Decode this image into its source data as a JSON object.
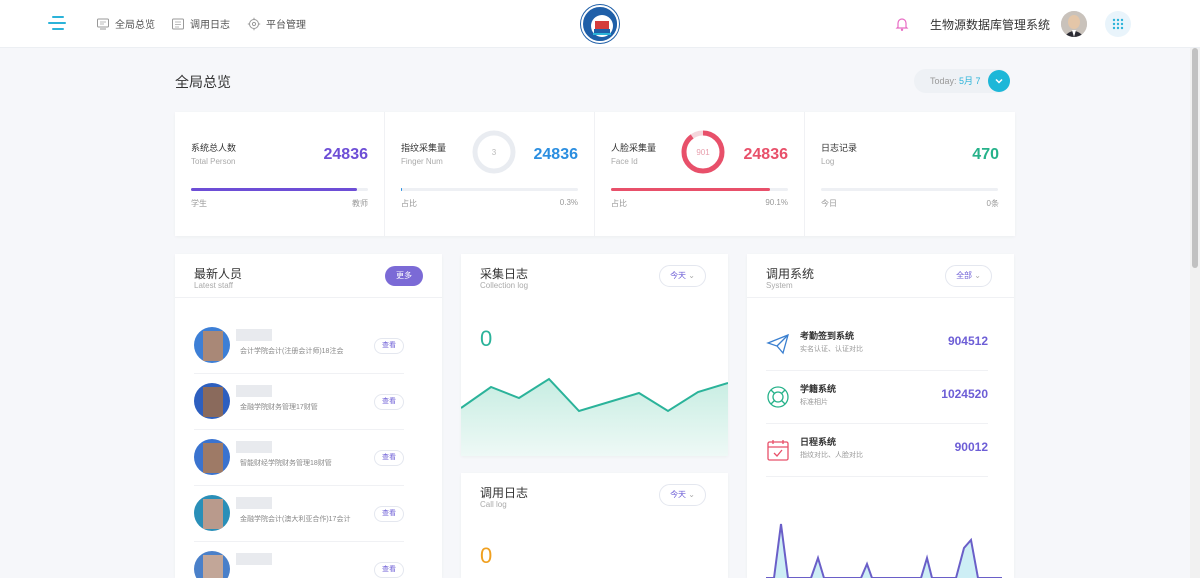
{
  "nav": {
    "items": [
      {
        "label": "全局总览",
        "icon": "monitor-icon"
      },
      {
        "label": "调用日志",
        "icon": "log-icon"
      },
      {
        "label": "平台管理",
        "icon": "gear-icon"
      }
    ],
    "system_title": "生物源数据库管理系统"
  },
  "page": {
    "title": "全局总览",
    "today_prefix": "Today: ",
    "today_month": "5月 7"
  },
  "stats": [
    {
      "label": "系统总人数",
      "sub": "Total Person",
      "value": "24836",
      "color": "#6d4ed6",
      "progress": 0.94,
      "foot_left": "学生",
      "foot_right": "教师"
    },
    {
      "label": "指纹采集量",
      "sub": "Finger Num",
      "value": "24836",
      "color": "#2b8ee0",
      "ring_value": "3",
      "progress": 0.003,
      "foot_left": "占比",
      "foot_right": "0.3%"
    },
    {
      "label": "人脸采集量",
      "sub": "Face Id",
      "value": "24836",
      "color": "#e8506a",
      "ring_value": "901",
      "progress": 0.901,
      "foot_left": "占比",
      "foot_right": "90.1%"
    },
    {
      "label": "日志记录",
      "sub": "Log",
      "value": "470",
      "color": "#26b28a",
      "progress": 0,
      "foot_left": "今日",
      "foot_right": "0条"
    }
  ],
  "staff": {
    "title": "最新人员",
    "sub": "Latest staff",
    "more": "更多",
    "view_label": "查看",
    "rows": [
      {
        "info": "会计学院会计(注册会计师)18注会"
      },
      {
        "info": "金融学院财务管理17财管"
      },
      {
        "info": "智能财经学院财务管理18财管"
      },
      {
        "info": "金融学院会计(澳大利亚合作)17会计"
      },
      {
        "info": ""
      }
    ]
  },
  "collect_log": {
    "title": "采集日志",
    "sub": "Collection log",
    "filter": "今天",
    "count": "0",
    "color": "#2bb39a"
  },
  "call_log": {
    "title": "调用日志",
    "sub": "Call log",
    "filter": "今天",
    "count": "0",
    "color": "#f0a020"
  },
  "systems": {
    "title": "调用系统",
    "sub": "System",
    "filter": "全部",
    "rows": [
      {
        "name": "考勤签到系统",
        "desc": "实名认证、认证对比",
        "value": "904512",
        "icon": "paper-plane-icon"
      },
      {
        "name": "学籍系统",
        "desc": "标准相片",
        "value": "1024520",
        "icon": "life-ring-icon"
      },
      {
        "name": "日程系统",
        "desc": "指纹对比、人脸对比",
        "value": "90012",
        "icon": "calendar-check-icon"
      }
    ]
  }
}
